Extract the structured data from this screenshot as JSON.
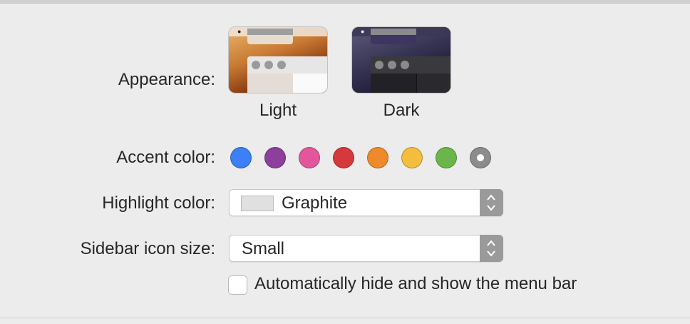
{
  "appearance": {
    "label": "Appearance:",
    "options": [
      {
        "name": "Light"
      },
      {
        "name": "Dark"
      }
    ]
  },
  "accent": {
    "label": "Accent color:",
    "colors": [
      "#3d7ff6",
      "#8d3f9b",
      "#e3569b",
      "#d5393b",
      "#ee8a2c",
      "#f5bd3e",
      "#6bb64b",
      "#8c8c8c"
    ],
    "selected_index": 7
  },
  "highlight": {
    "label": "Highlight color:",
    "value": "Graphite"
  },
  "sidebar_icon_size": {
    "label": "Sidebar icon size:",
    "value": "Small"
  },
  "menubar": {
    "label": "Automatically hide and show the menu bar",
    "checked": false
  }
}
